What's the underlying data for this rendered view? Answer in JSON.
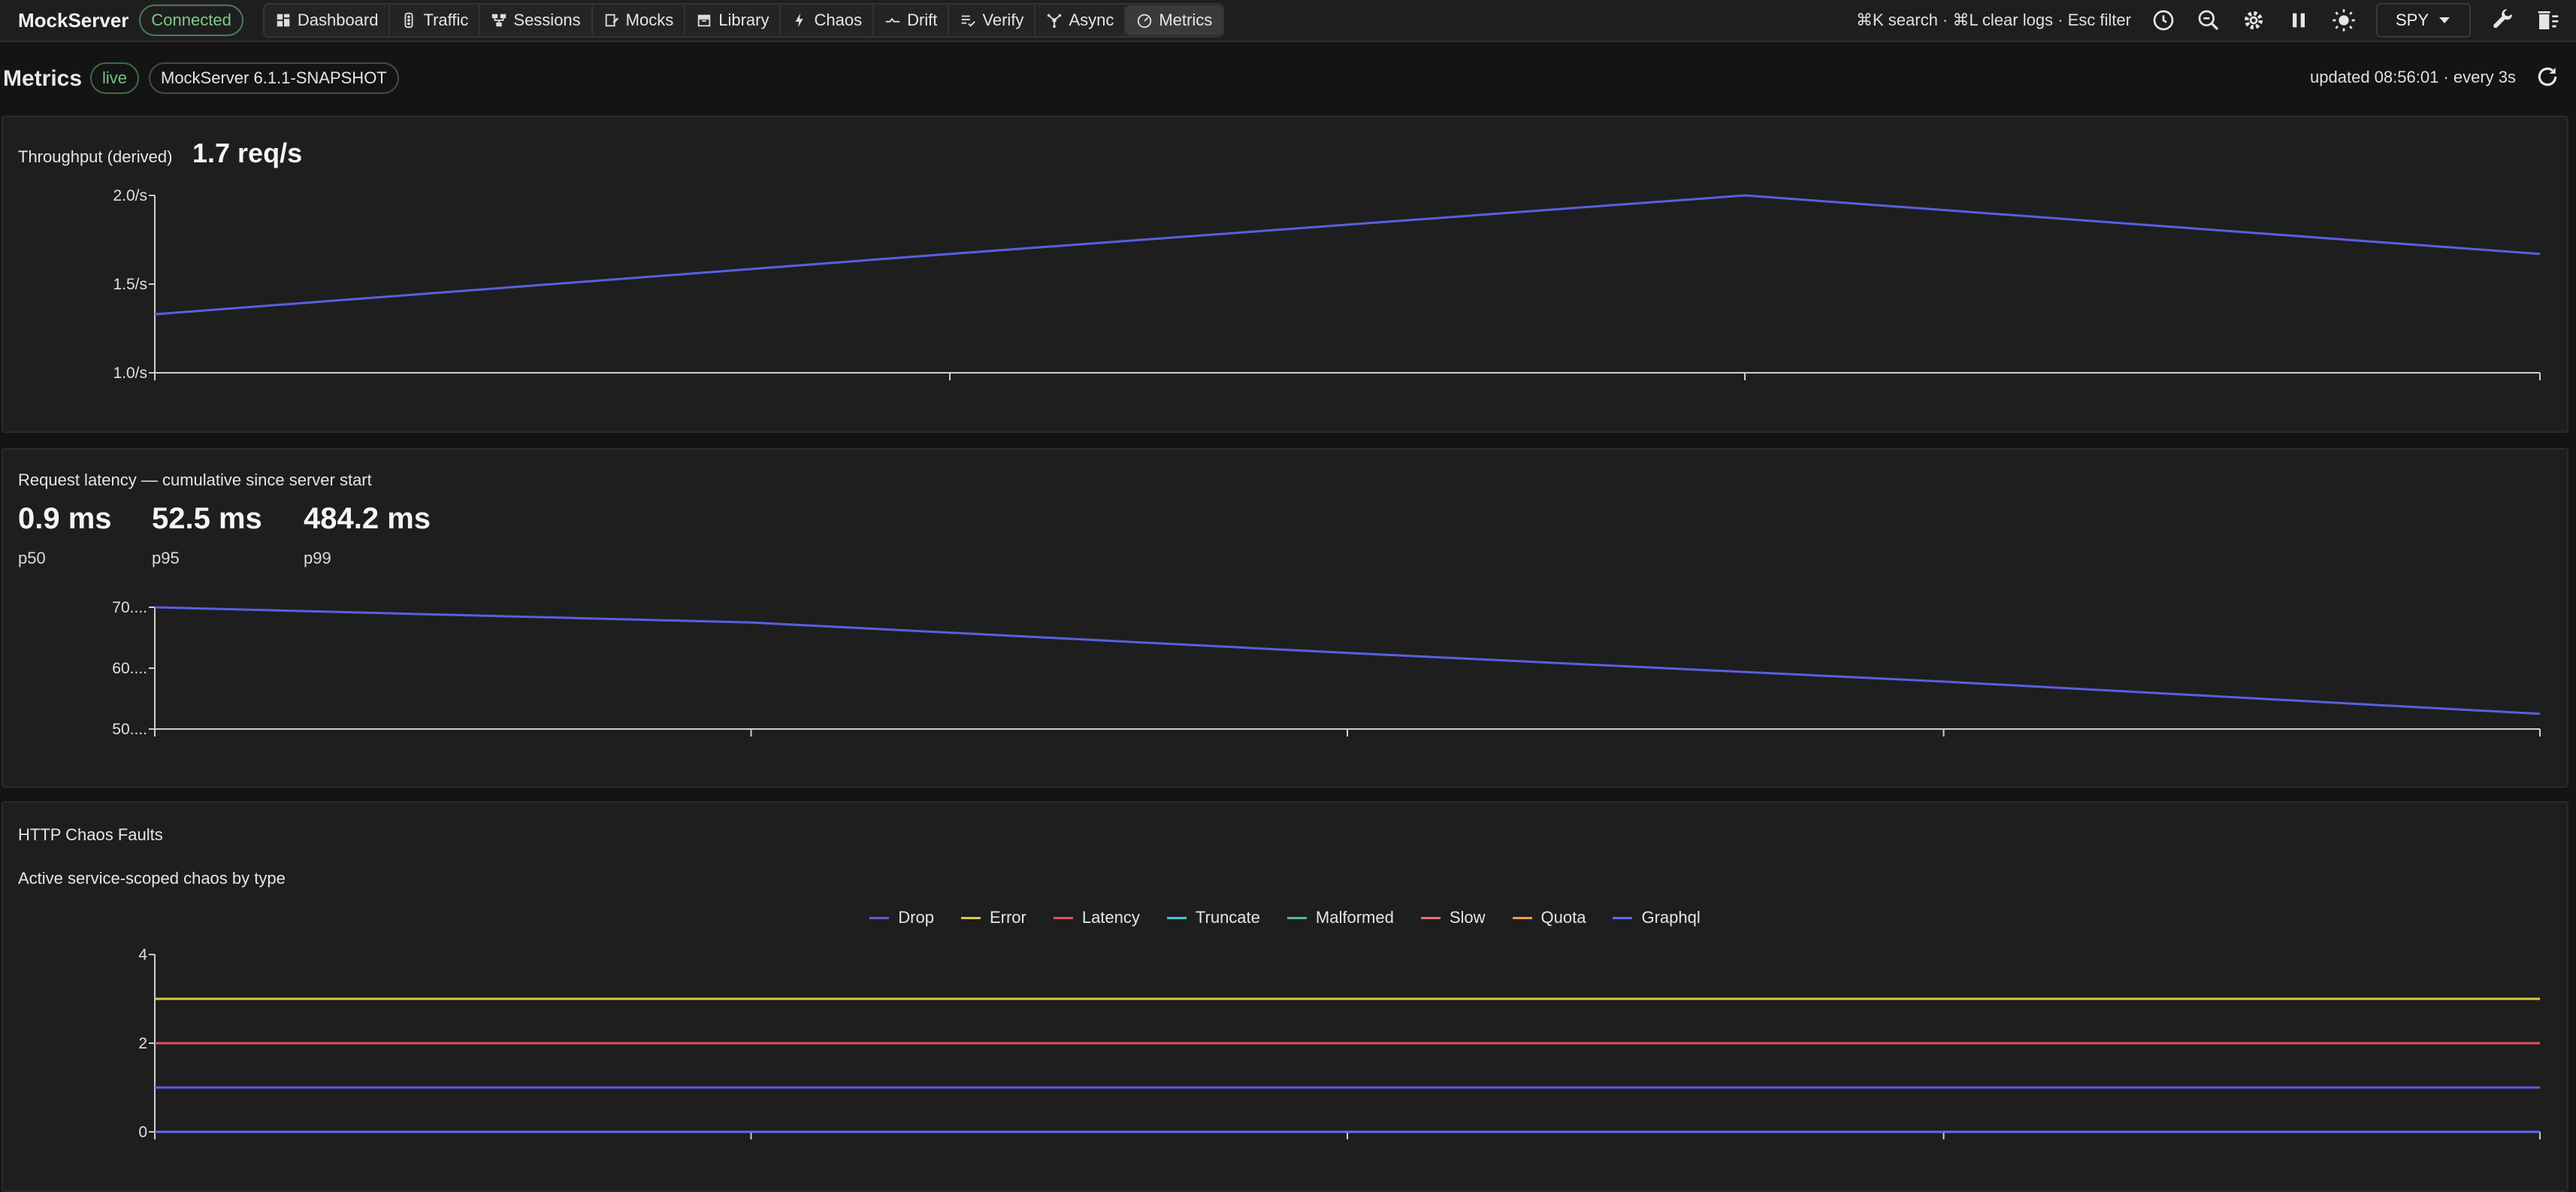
{
  "topbar": {
    "brand": "MockServer",
    "status": "Connected",
    "nav": [
      {
        "label": "Dashboard",
        "icon": "dashboard-icon",
        "active": false
      },
      {
        "label": "Traffic",
        "icon": "traffic-icon",
        "active": false
      },
      {
        "label": "Sessions",
        "icon": "sessions-icon",
        "active": false
      },
      {
        "label": "Mocks",
        "icon": "mocks-icon",
        "active": false
      },
      {
        "label": "Library",
        "icon": "library-icon",
        "active": false
      },
      {
        "label": "Chaos",
        "icon": "bolt-icon",
        "active": false
      },
      {
        "label": "Drift",
        "icon": "drift-icon",
        "active": false
      },
      {
        "label": "Verify",
        "icon": "verify-icon",
        "active": false
      },
      {
        "label": "Async",
        "icon": "async-icon",
        "active": false
      },
      {
        "label": "Metrics",
        "icon": "gauge-icon",
        "active": true
      }
    ],
    "shortcuts": "⌘K search · ⌘L clear logs · Esc filter",
    "mode": "SPY"
  },
  "header": {
    "title": "Metrics",
    "live": "live",
    "version": "MockServer 6.1.1-SNAPSHOT",
    "updated": "updated 08:56:01 · every 3s"
  },
  "throughput": {
    "label": "Throughput (derived)",
    "value": "1.7 req/s"
  },
  "latency": {
    "label": "Request latency — cumulative since server start",
    "stats": [
      {
        "value": "0.9 ms",
        "label": "p50"
      },
      {
        "value": "52.5 ms",
        "label": "p95"
      },
      {
        "value": "484.2 ms",
        "label": "p99"
      }
    ]
  },
  "chaos": {
    "title": "HTTP Chaos Faults",
    "subtitle": "Active service-scoped chaos by type"
  },
  "colors": {
    "drop": "#5b5ee0",
    "error": "#e6c34a",
    "latency": "#e05555",
    "truncate": "#3fc6d8",
    "malformed": "#48c38a",
    "slow": "#e86a7a",
    "quota": "#f0a040",
    "graphql": "#5b6ef0"
  },
  "chart_data": [
    {
      "type": "line",
      "x": [
        0,
        1,
        2,
        3
      ],
      "series": [
        {
          "values": [
            1.33,
            1.67,
            2.0,
            1.67
          ]
        }
      ],
      "yticks": [
        "1.0/s",
        "1.5/s",
        "2.0/s"
      ],
      "ylim": [
        1.0,
        2.0
      ]
    },
    {
      "type": "line",
      "x": [
        0,
        1,
        2,
        3,
        4
      ],
      "series": [
        {
          "values": [
            70.0,
            67.5,
            62.5,
            57.8,
            52.5
          ]
        }
      ],
      "yticks": [
        "50....",
        "60....",
        "70...."
      ],
      "ylim": [
        50,
        70
      ]
    },
    {
      "type": "line",
      "x": [
        0,
        1,
        2,
        3,
        4
      ],
      "series": [
        {
          "name": "Drop",
          "values": [
            1,
            1,
            1,
            1,
            1
          ]
        },
        {
          "name": "Error",
          "values": [
            3,
            3,
            3,
            3,
            3
          ]
        },
        {
          "name": "Latency",
          "values": [
            2,
            2,
            2,
            2,
            2
          ]
        },
        {
          "name": "Truncate",
          "values": [
            0,
            0,
            0,
            0,
            0
          ]
        },
        {
          "name": "Malformed",
          "values": [
            0,
            0,
            0,
            0,
            0
          ]
        },
        {
          "name": "Slow",
          "values": [
            0,
            0,
            0,
            0,
            0
          ]
        },
        {
          "name": "Quota",
          "values": [
            0,
            0,
            0,
            0,
            0
          ]
        },
        {
          "name": "Graphql",
          "values": [
            0,
            0,
            0,
            0,
            0
          ]
        }
      ],
      "yticks": [
        "0",
        "2",
        "4"
      ],
      "ylim": [
        0,
        4
      ]
    }
  ]
}
